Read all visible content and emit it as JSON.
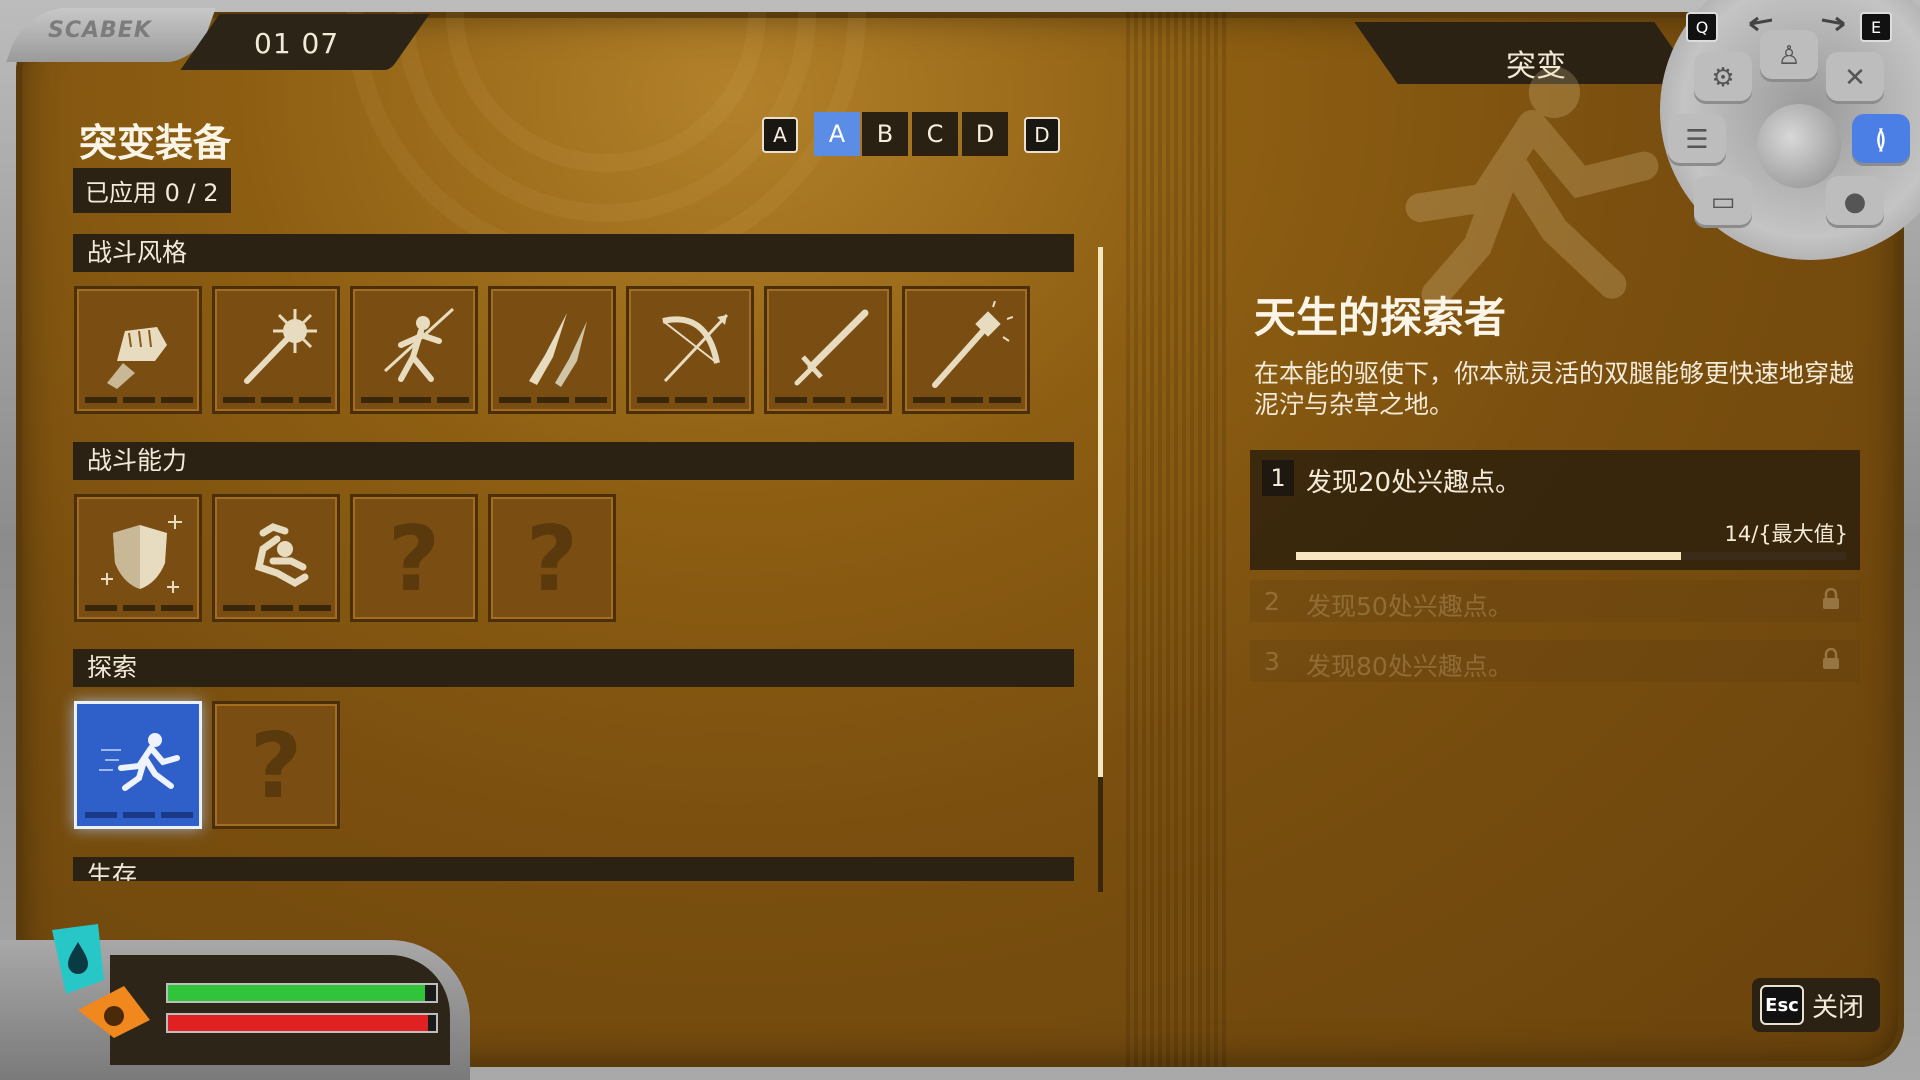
{
  "top": {
    "brand": "SCABEK",
    "time": "01  07"
  },
  "left": {
    "title": "突变装备",
    "applied": "已应用 0 / 2",
    "loadout_tabs": [
      {
        "label": "A",
        "style": "key"
      },
      {
        "label": "A",
        "style": "selected"
      },
      {
        "label": "B",
        "style": "normal"
      },
      {
        "label": "C",
        "style": "normal"
      },
      {
        "label": "D",
        "style": "normal"
      },
      {
        "label": "D",
        "style": "key"
      }
    ],
    "sections": [
      {
        "title": "战斗风格",
        "slots": [
          "fist-icon",
          "mace-icon",
          "spear-thrower-icon",
          "dual-daggers-icon",
          "bow-icon",
          "sword-icon",
          "staff-icon"
        ]
      },
      {
        "title": "战斗能力",
        "slots": [
          "shield-icon",
          "dodge-roll-icon",
          "locked",
          "locked"
        ]
      },
      {
        "title": "探索",
        "slots": [
          "runner-icon",
          "locked"
        ]
      },
      {
        "title": "生存",
        "slots": []
      }
    ],
    "locked_glyph": "?"
  },
  "right": {
    "header": "突变",
    "perk_name": "天生的探索者",
    "perk_desc": "在本能的驱使下，你本就灵活的双腿能够更快速地穿越泥泞与杂草之地。",
    "requirements": [
      {
        "num": "1",
        "text": "发现20处兴趣点。",
        "progress_text": "14/{最大值}",
        "progress": 0.7,
        "locked": false
      },
      {
        "num": "2",
        "text": "发现50处兴趣点。",
        "locked": true
      },
      {
        "num": "3",
        "text": "发现80处兴趣点。",
        "locked": true
      }
    ],
    "close": {
      "key": "Esc",
      "label": "关闭"
    }
  },
  "wheel": {
    "prev_key": "Q",
    "next_key": "E",
    "active": "dna-icon"
  },
  "hud": {
    "energy": 0.96,
    "health": 0.97,
    "colors": {
      "energy": "#2fc43a",
      "health": "#e12121",
      "selected": "#2f5fc8"
    }
  }
}
